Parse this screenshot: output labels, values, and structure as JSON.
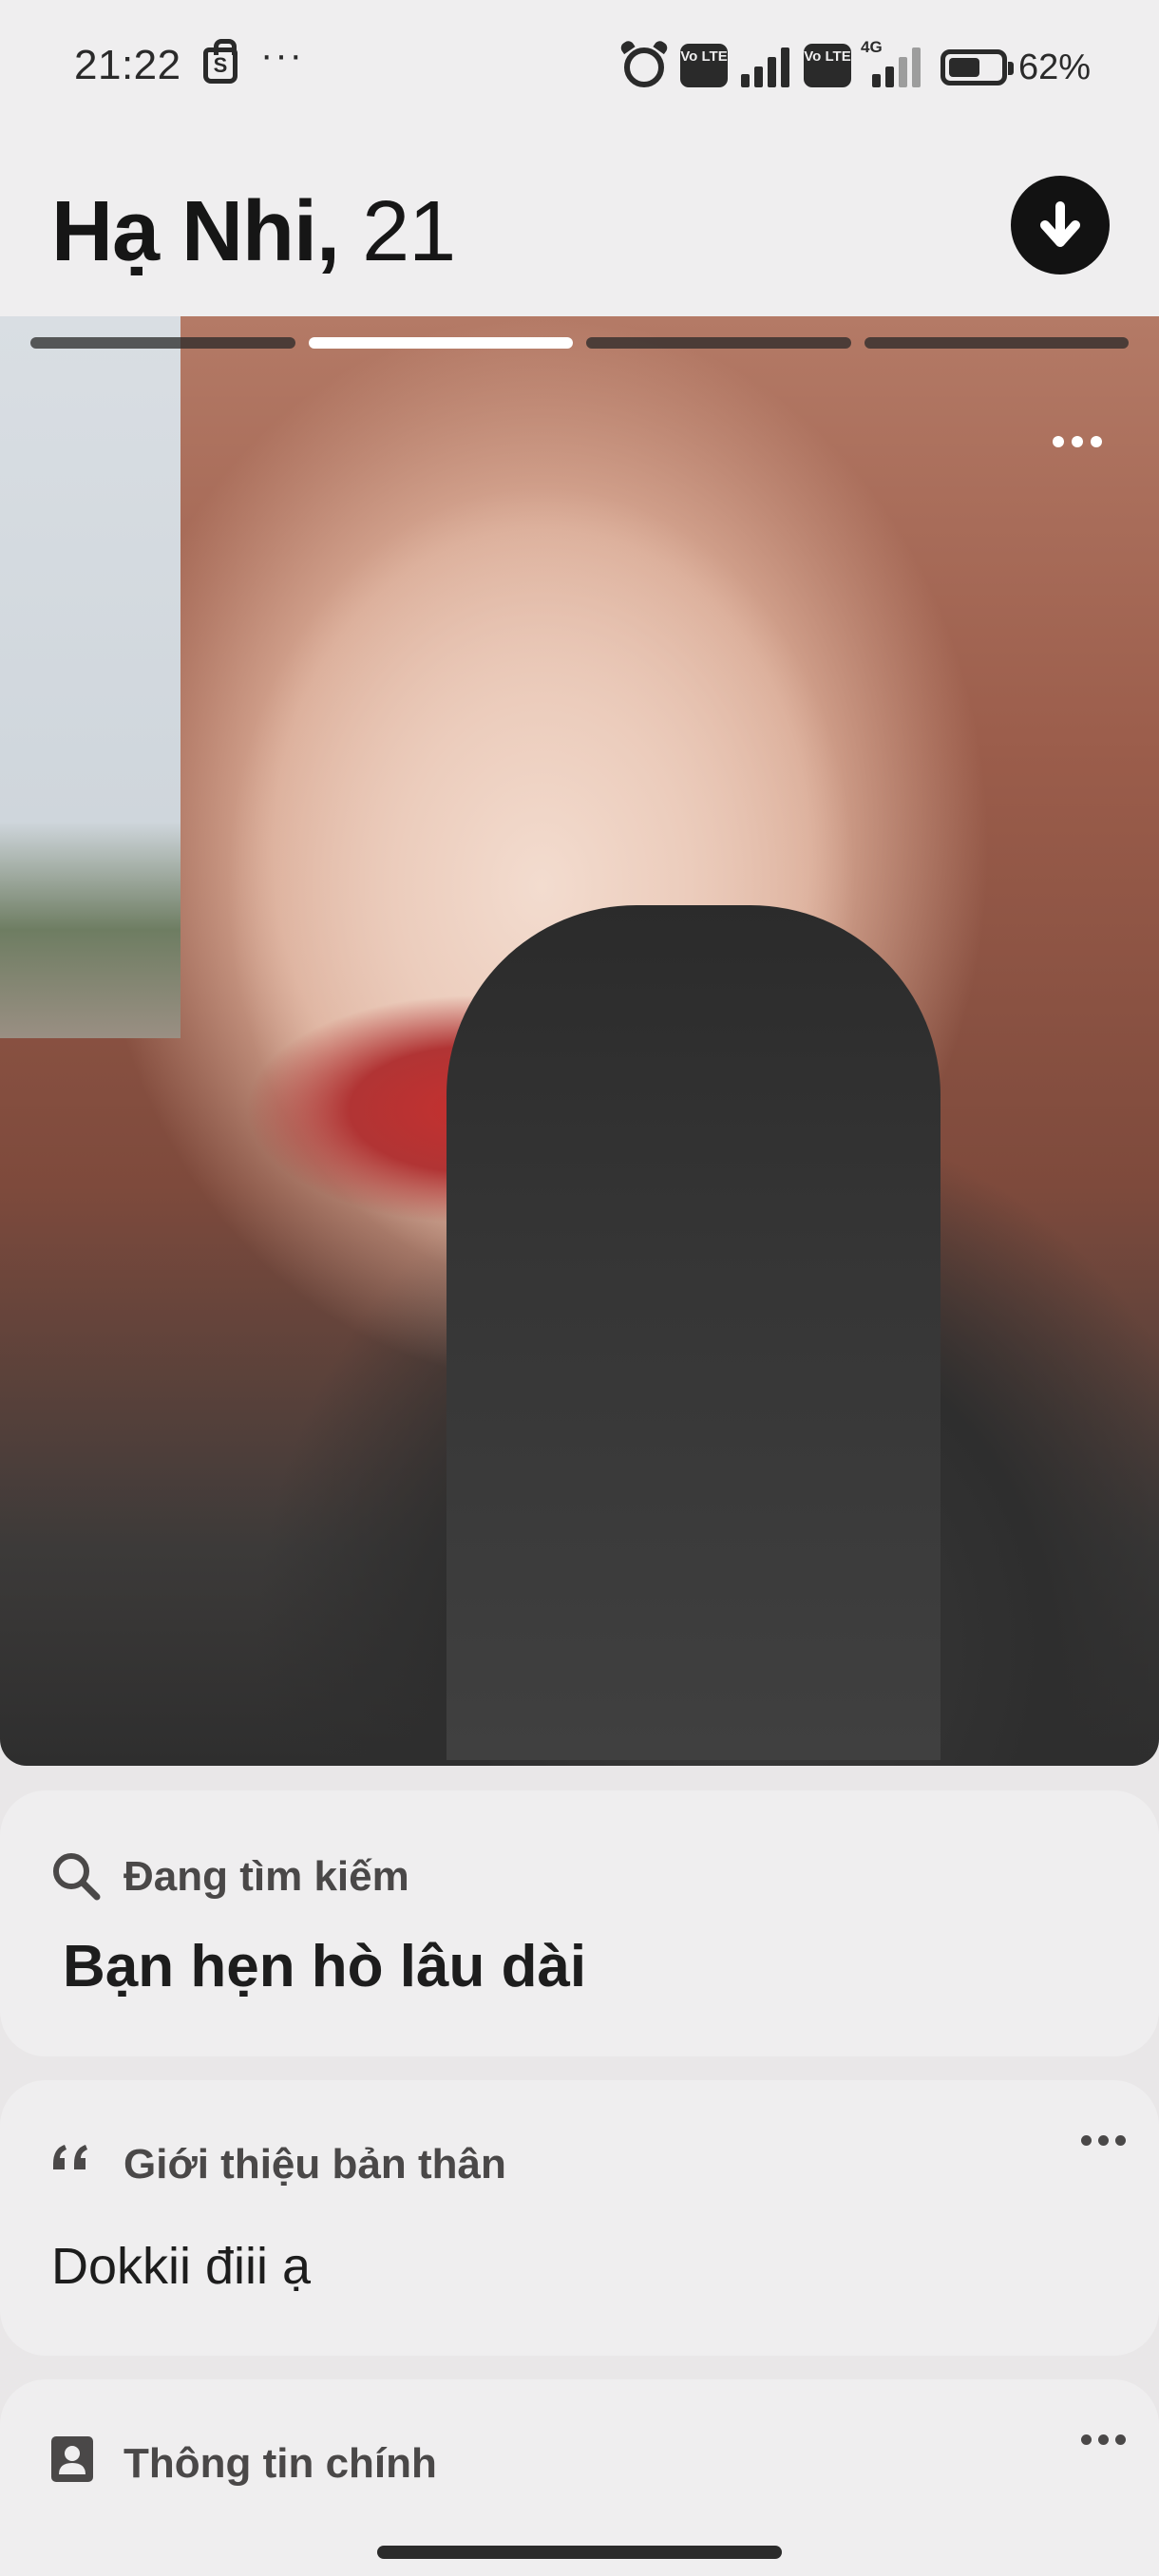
{
  "status_bar": {
    "time": "21:22",
    "shop_icon_letter": "S",
    "more_indicator": "···",
    "sim1_label": "Vo LTE",
    "sim2_label": "Vo LTE",
    "network_type": "4G",
    "battery_level": 0.62,
    "battery_text": "62%"
  },
  "profile": {
    "name": "Hạ Nhi,",
    "age": "21"
  },
  "photo": {
    "photo_count": 4,
    "active_index": 1
  },
  "looking_for": {
    "label": "Đang tìm kiếm",
    "value": "Bạn hẹn hò lâu dài"
  },
  "about": {
    "label": "Giới thiệu bản thân",
    "value": "Dokkii điii ạ"
  },
  "main_info": {
    "label": "Thông tin chính"
  },
  "icons": {
    "collapse": "arrow-down-icon",
    "search": "search-icon",
    "quote": "quote-icon",
    "badge": "contact-badge-icon"
  },
  "colors": {
    "background": "#efeeef",
    "accent_dark": "#121212",
    "label_gray": "#4a4848"
  }
}
